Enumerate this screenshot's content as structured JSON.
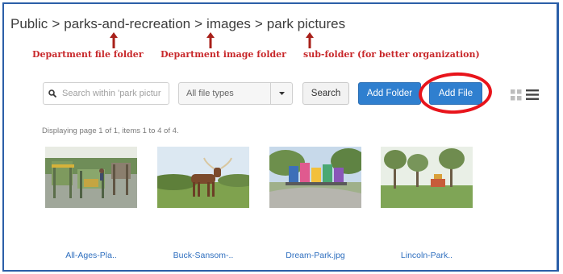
{
  "breadcrumb": {
    "items": [
      "Public",
      "parks-and-recreation",
      "images",
      "park pictures"
    ],
    "separator": ">"
  },
  "annotations": {
    "dept_file_folder": "Department file folder",
    "dept_image_folder": "Department image folder",
    "sub_folder": "sub-folder (for better organization)",
    "color": "#c8282b"
  },
  "toolbar": {
    "search_placeholder": "Search within 'park pictur",
    "file_type_selected": "All file types",
    "search_label": "Search",
    "add_folder_label": "Add Folder",
    "add_file_label": "Add File",
    "accent_color": "#2f7fcf",
    "highlight_color": "#e8141b"
  },
  "status": "Displaying page 1 of 1, items 1 to 4 of 4.",
  "files": [
    {
      "name": "All-Ages-Pla.."
    },
    {
      "name": "Buck-Sansom-.."
    },
    {
      "name": "Dream-Park.jpg"
    },
    {
      "name": "Lincoln-Park.."
    }
  ]
}
